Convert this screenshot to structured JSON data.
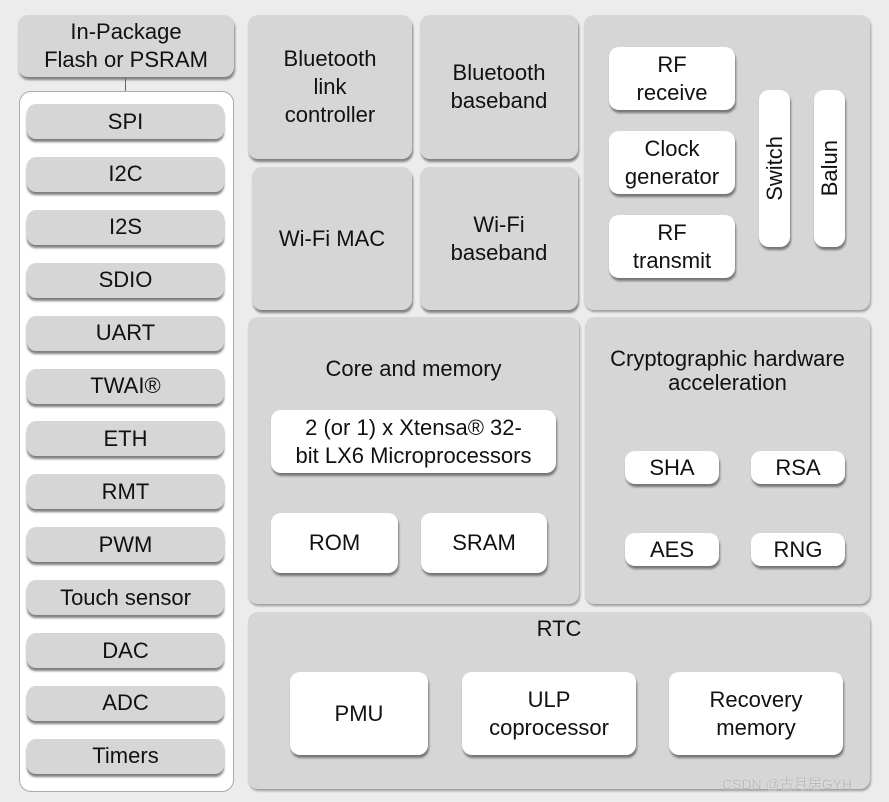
{
  "flash": {
    "label_line1": "In-Package",
    "label_line2": "Flash or PSRAM"
  },
  "peripherals": [
    "SPI",
    "I2C",
    "I2S",
    "SDIO",
    "UART",
    "TWAI®",
    "ETH",
    "RMT",
    "PWM",
    "Touch sensor",
    "DAC",
    "ADC",
    "Timers"
  ],
  "bluetooth_link": {
    "line1": "Bluetooth",
    "line2": "link",
    "line3": "controller"
  },
  "bluetooth_baseband": {
    "line1": "Bluetooth",
    "line2": "baseband"
  },
  "wifi_mac": {
    "label": "Wi-Fi MAC"
  },
  "wifi_baseband": {
    "line1": "Wi-Fi",
    "line2": "baseband"
  },
  "rf": {
    "receive": {
      "line1": "RF",
      "line2": "receive"
    },
    "clock": {
      "line1": "Clock",
      "line2": "generator"
    },
    "transmit": {
      "line1": "RF",
      "line2": "transmit"
    },
    "switch": "Switch",
    "balun": "Balun"
  },
  "core": {
    "title": "Core and memory",
    "cpu_line1": "2 (or 1) x Xtensa® 32-",
    "cpu_line2": "bit LX6 Microprocessors",
    "rom": "ROM",
    "sram": "SRAM"
  },
  "crypto": {
    "title_line1": "Cryptographic hardware",
    "title_line2": "acceleration",
    "sha": "SHA",
    "rsa": "RSA",
    "aes": "AES",
    "rng": "RNG"
  },
  "rtc": {
    "title": "RTC",
    "pmu": "PMU",
    "ulp_line1": "ULP",
    "ulp_line2": "coprocessor",
    "recovery_line1": "Recovery",
    "recovery_line2": "memory"
  },
  "watermark": "CSDN @古月居GYH"
}
